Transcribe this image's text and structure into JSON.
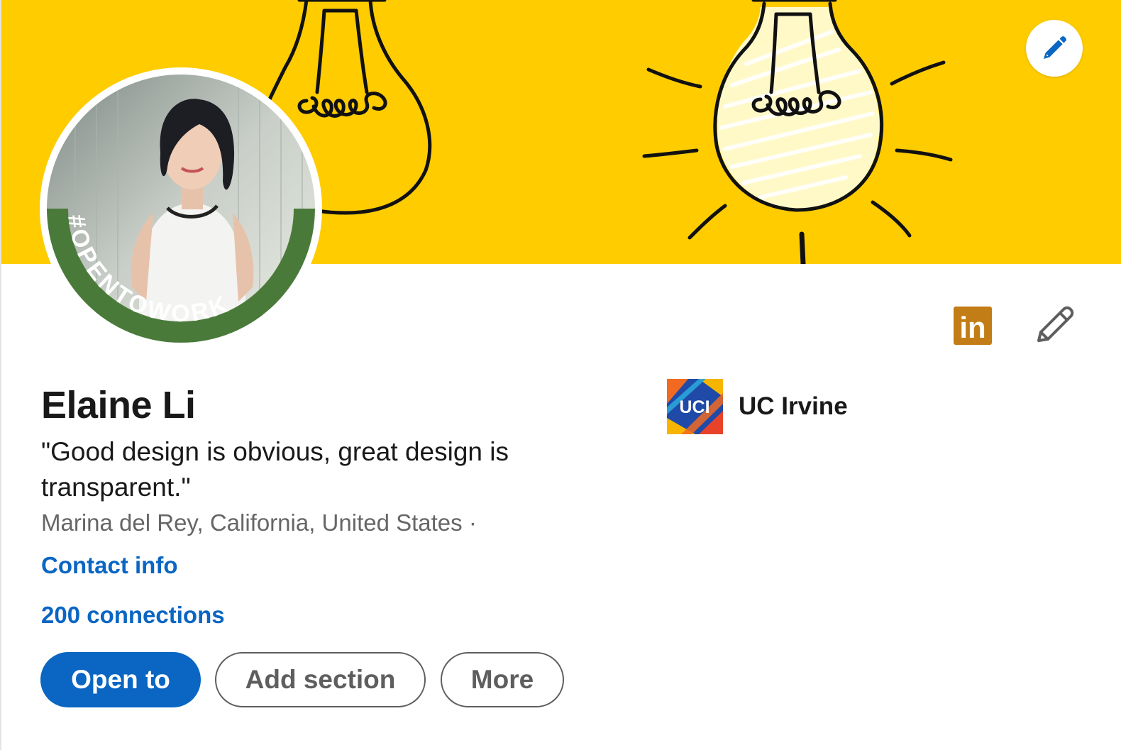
{
  "profile": {
    "name": "Elaine Li",
    "headline": "\"Good design is obvious, great design is transparent.\"",
    "location": "Marina del Rey, California, United States",
    "location_separator": "·",
    "contact_info": "Contact info",
    "connections": "200 connections",
    "open_to_work_text": "#OPENTOWORK"
  },
  "actions": {
    "open_to": "Open to",
    "add_section": "Add section",
    "more": "More"
  },
  "education": {
    "school_name": "UC Irvine",
    "logo_text": "UCI"
  },
  "badges": {
    "linkedin_text": "in"
  },
  "colors": {
    "banner": "#FFCC00",
    "primary": "#0a66c2",
    "open_to_work_ring": "#4a7a3a",
    "linkedin_badge": "#c37d16"
  },
  "icons": {
    "cover_edit": "pencil-icon",
    "intro_edit": "pencil-icon",
    "linkedin": "linkedin-icon"
  }
}
